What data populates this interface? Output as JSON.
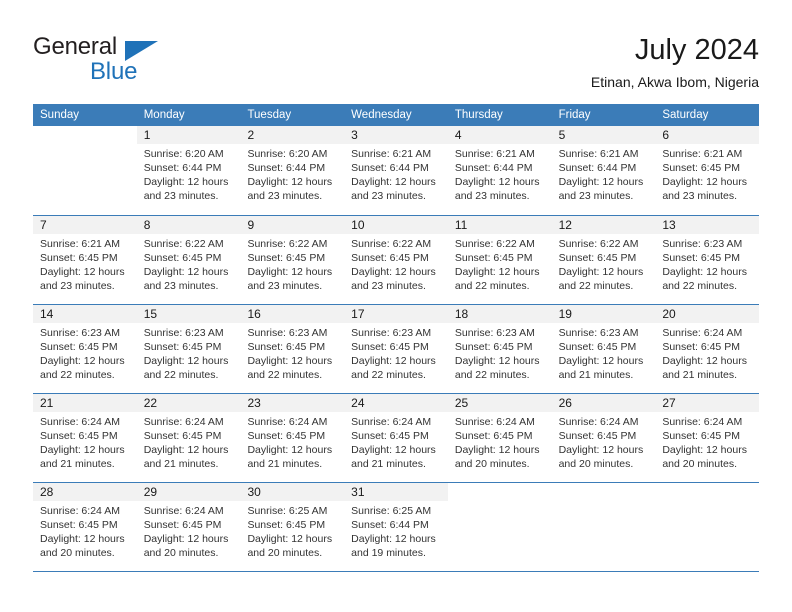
{
  "brand": {
    "name_part1": "General",
    "name_part2": "Blue",
    "accent_color": "#1f72b8"
  },
  "header": {
    "title": "July 2024",
    "subtitle": "Etinan, Akwa Ibom, Nigeria"
  },
  "calendar": {
    "header_color": "#3b7cb8",
    "weekdays": [
      "Sunday",
      "Monday",
      "Tuesday",
      "Wednesday",
      "Thursday",
      "Friday",
      "Saturday"
    ],
    "weeks": [
      [
        {
          "day": "",
          "lines": []
        },
        {
          "day": "1",
          "lines": [
            "Sunrise: 6:20 AM",
            "Sunset: 6:44 PM",
            "Daylight: 12 hours",
            "and 23 minutes."
          ]
        },
        {
          "day": "2",
          "lines": [
            "Sunrise: 6:20 AM",
            "Sunset: 6:44 PM",
            "Daylight: 12 hours",
            "and 23 minutes."
          ]
        },
        {
          "day": "3",
          "lines": [
            "Sunrise: 6:21 AM",
            "Sunset: 6:44 PM",
            "Daylight: 12 hours",
            "and 23 minutes."
          ]
        },
        {
          "day": "4",
          "lines": [
            "Sunrise: 6:21 AM",
            "Sunset: 6:44 PM",
            "Daylight: 12 hours",
            "and 23 minutes."
          ]
        },
        {
          "day": "5",
          "lines": [
            "Sunrise: 6:21 AM",
            "Sunset: 6:44 PM",
            "Daylight: 12 hours",
            "and 23 minutes."
          ]
        },
        {
          "day": "6",
          "lines": [
            "Sunrise: 6:21 AM",
            "Sunset: 6:45 PM",
            "Daylight: 12 hours",
            "and 23 minutes."
          ]
        }
      ],
      [
        {
          "day": "7",
          "lines": [
            "Sunrise: 6:21 AM",
            "Sunset: 6:45 PM",
            "Daylight: 12 hours",
            "and 23 minutes."
          ]
        },
        {
          "day": "8",
          "lines": [
            "Sunrise: 6:22 AM",
            "Sunset: 6:45 PM",
            "Daylight: 12 hours",
            "and 23 minutes."
          ]
        },
        {
          "day": "9",
          "lines": [
            "Sunrise: 6:22 AM",
            "Sunset: 6:45 PM",
            "Daylight: 12 hours",
            "and 23 minutes."
          ]
        },
        {
          "day": "10",
          "lines": [
            "Sunrise: 6:22 AM",
            "Sunset: 6:45 PM",
            "Daylight: 12 hours",
            "and 23 minutes."
          ]
        },
        {
          "day": "11",
          "lines": [
            "Sunrise: 6:22 AM",
            "Sunset: 6:45 PM",
            "Daylight: 12 hours",
            "and 22 minutes."
          ]
        },
        {
          "day": "12",
          "lines": [
            "Sunrise: 6:22 AM",
            "Sunset: 6:45 PM",
            "Daylight: 12 hours",
            "and 22 minutes."
          ]
        },
        {
          "day": "13",
          "lines": [
            "Sunrise: 6:23 AM",
            "Sunset: 6:45 PM",
            "Daylight: 12 hours",
            "and 22 minutes."
          ]
        }
      ],
      [
        {
          "day": "14",
          "lines": [
            "Sunrise: 6:23 AM",
            "Sunset: 6:45 PM",
            "Daylight: 12 hours",
            "and 22 minutes."
          ]
        },
        {
          "day": "15",
          "lines": [
            "Sunrise: 6:23 AM",
            "Sunset: 6:45 PM",
            "Daylight: 12 hours",
            "and 22 minutes."
          ]
        },
        {
          "day": "16",
          "lines": [
            "Sunrise: 6:23 AM",
            "Sunset: 6:45 PM",
            "Daylight: 12 hours",
            "and 22 minutes."
          ]
        },
        {
          "day": "17",
          "lines": [
            "Sunrise: 6:23 AM",
            "Sunset: 6:45 PM",
            "Daylight: 12 hours",
            "and 22 minutes."
          ]
        },
        {
          "day": "18",
          "lines": [
            "Sunrise: 6:23 AM",
            "Sunset: 6:45 PM",
            "Daylight: 12 hours",
            "and 22 minutes."
          ]
        },
        {
          "day": "19",
          "lines": [
            "Sunrise: 6:23 AM",
            "Sunset: 6:45 PM",
            "Daylight: 12 hours",
            "and 21 minutes."
          ]
        },
        {
          "day": "20",
          "lines": [
            "Sunrise: 6:24 AM",
            "Sunset: 6:45 PM",
            "Daylight: 12 hours",
            "and 21 minutes."
          ]
        }
      ],
      [
        {
          "day": "21",
          "lines": [
            "Sunrise: 6:24 AM",
            "Sunset: 6:45 PM",
            "Daylight: 12 hours",
            "and 21 minutes."
          ]
        },
        {
          "day": "22",
          "lines": [
            "Sunrise: 6:24 AM",
            "Sunset: 6:45 PM",
            "Daylight: 12 hours",
            "and 21 minutes."
          ]
        },
        {
          "day": "23",
          "lines": [
            "Sunrise: 6:24 AM",
            "Sunset: 6:45 PM",
            "Daylight: 12 hours",
            "and 21 minutes."
          ]
        },
        {
          "day": "24",
          "lines": [
            "Sunrise: 6:24 AM",
            "Sunset: 6:45 PM",
            "Daylight: 12 hours",
            "and 21 minutes."
          ]
        },
        {
          "day": "25",
          "lines": [
            "Sunrise: 6:24 AM",
            "Sunset: 6:45 PM",
            "Daylight: 12 hours",
            "and 20 minutes."
          ]
        },
        {
          "day": "26",
          "lines": [
            "Sunrise: 6:24 AM",
            "Sunset: 6:45 PM",
            "Daylight: 12 hours",
            "and 20 minutes."
          ]
        },
        {
          "day": "27",
          "lines": [
            "Sunrise: 6:24 AM",
            "Sunset: 6:45 PM",
            "Daylight: 12 hours",
            "and 20 minutes."
          ]
        }
      ],
      [
        {
          "day": "28",
          "lines": [
            "Sunrise: 6:24 AM",
            "Sunset: 6:45 PM",
            "Daylight: 12 hours",
            "and 20 minutes."
          ]
        },
        {
          "day": "29",
          "lines": [
            "Sunrise: 6:24 AM",
            "Sunset: 6:45 PM",
            "Daylight: 12 hours",
            "and 20 minutes."
          ]
        },
        {
          "day": "30",
          "lines": [
            "Sunrise: 6:25 AM",
            "Sunset: 6:45 PM",
            "Daylight: 12 hours",
            "and 20 minutes."
          ]
        },
        {
          "day": "31",
          "lines": [
            "Sunrise: 6:25 AM",
            "Sunset: 6:44 PM",
            "Daylight: 12 hours",
            "and 19 minutes."
          ]
        },
        {
          "day": "",
          "lines": []
        },
        {
          "day": "",
          "lines": []
        },
        {
          "day": "",
          "lines": []
        }
      ]
    ]
  }
}
